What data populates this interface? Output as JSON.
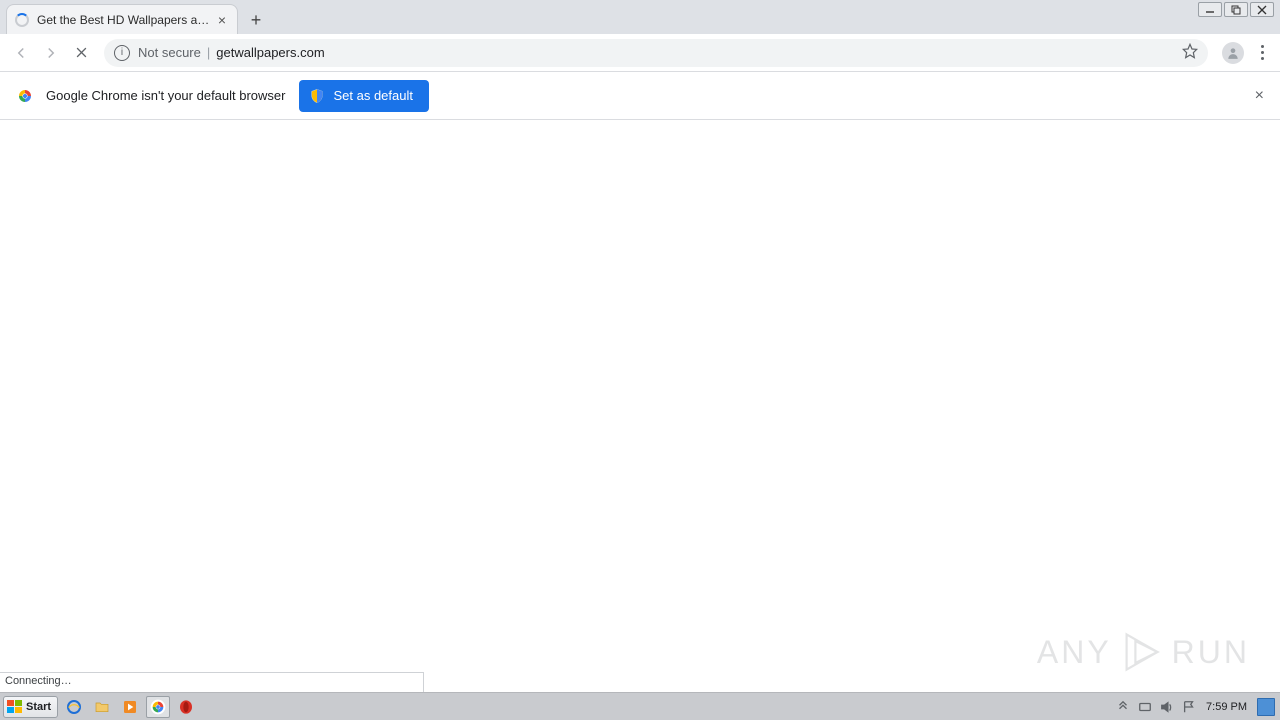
{
  "tab": {
    "title": "Get the Best HD Wallpapers and Backgrounds"
  },
  "address": {
    "security_label": "Not secure",
    "url": "getwallpapers.com"
  },
  "infobar": {
    "message": "Google Chrome isn't your default browser",
    "button_label": "Set as default"
  },
  "status": {
    "text": "Connecting…"
  },
  "watermark": {
    "left": "ANY",
    "right": "RUN"
  },
  "taskbar": {
    "start_label": "Start",
    "clock": "7:59 PM"
  }
}
